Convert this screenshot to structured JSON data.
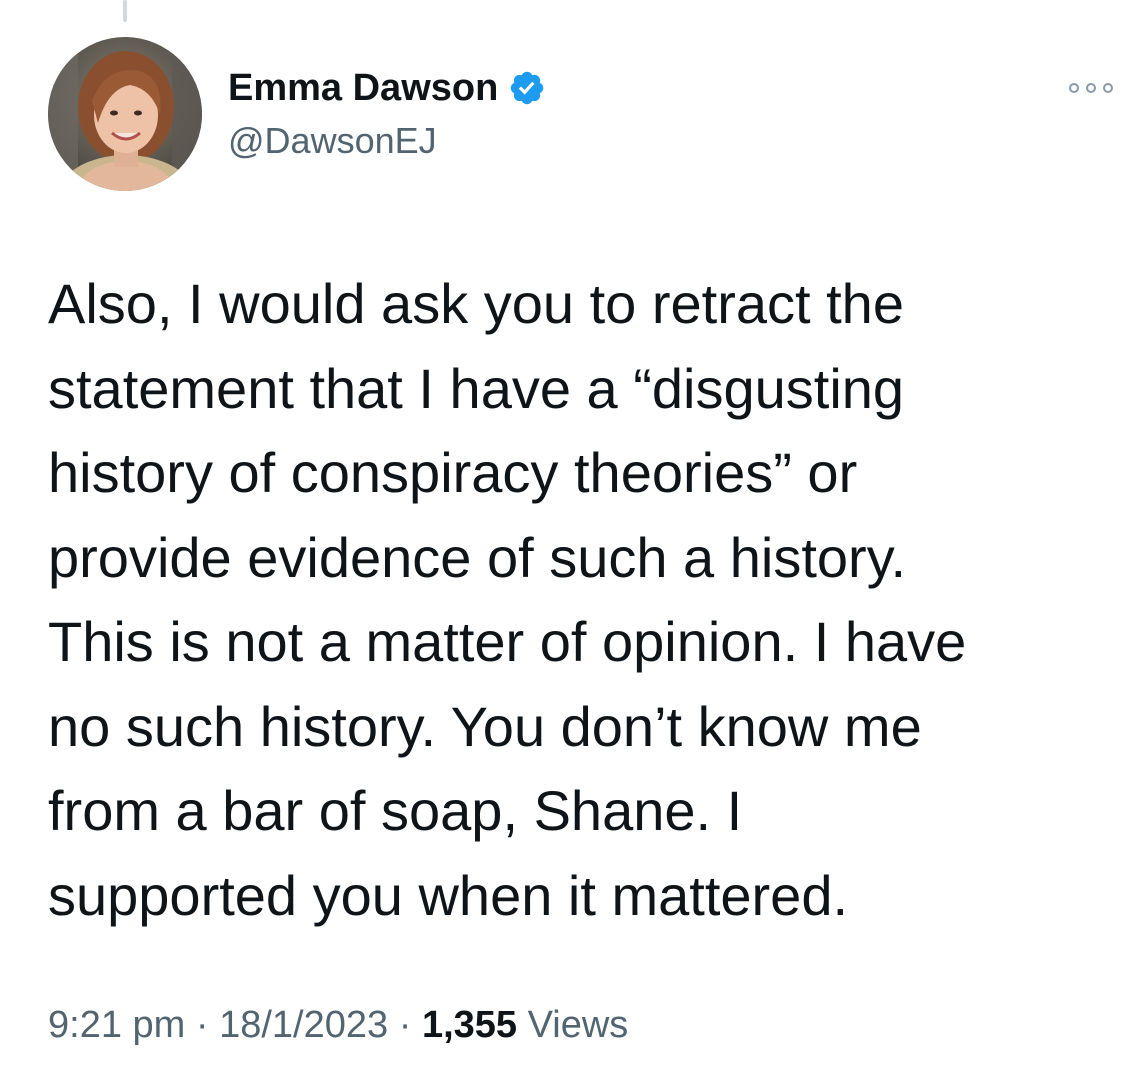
{
  "tweet": {
    "author": {
      "display_name": "Emma Dawson",
      "handle": "@DawsonEJ",
      "verified": true,
      "verified_color": "#1d9bf0"
    },
    "text": "Also, I would ask you to retract the\nstatement that I have a “disgusting\nhistory of conspiracy theories” or\nprovide evidence of such a history.\nThis is not a matter of opinion. I have\nno such history. You don’t know me\nfrom a bar of soap, Shane. I\nsupported you when it mattered.",
    "time": "9:21 pm",
    "separator": "·",
    "date": "18/1/2023",
    "views_count": "1,355",
    "views_label": "Views"
  },
  "icons": {
    "avatar": "profile-photo",
    "verified": "verified-badge-icon",
    "more": "more-options-icon"
  },
  "colors": {
    "text_primary": "#0f1419",
    "text_secondary": "#536471",
    "thread_line": "#cfd9de",
    "verified_blue": "#1d9bf0"
  }
}
